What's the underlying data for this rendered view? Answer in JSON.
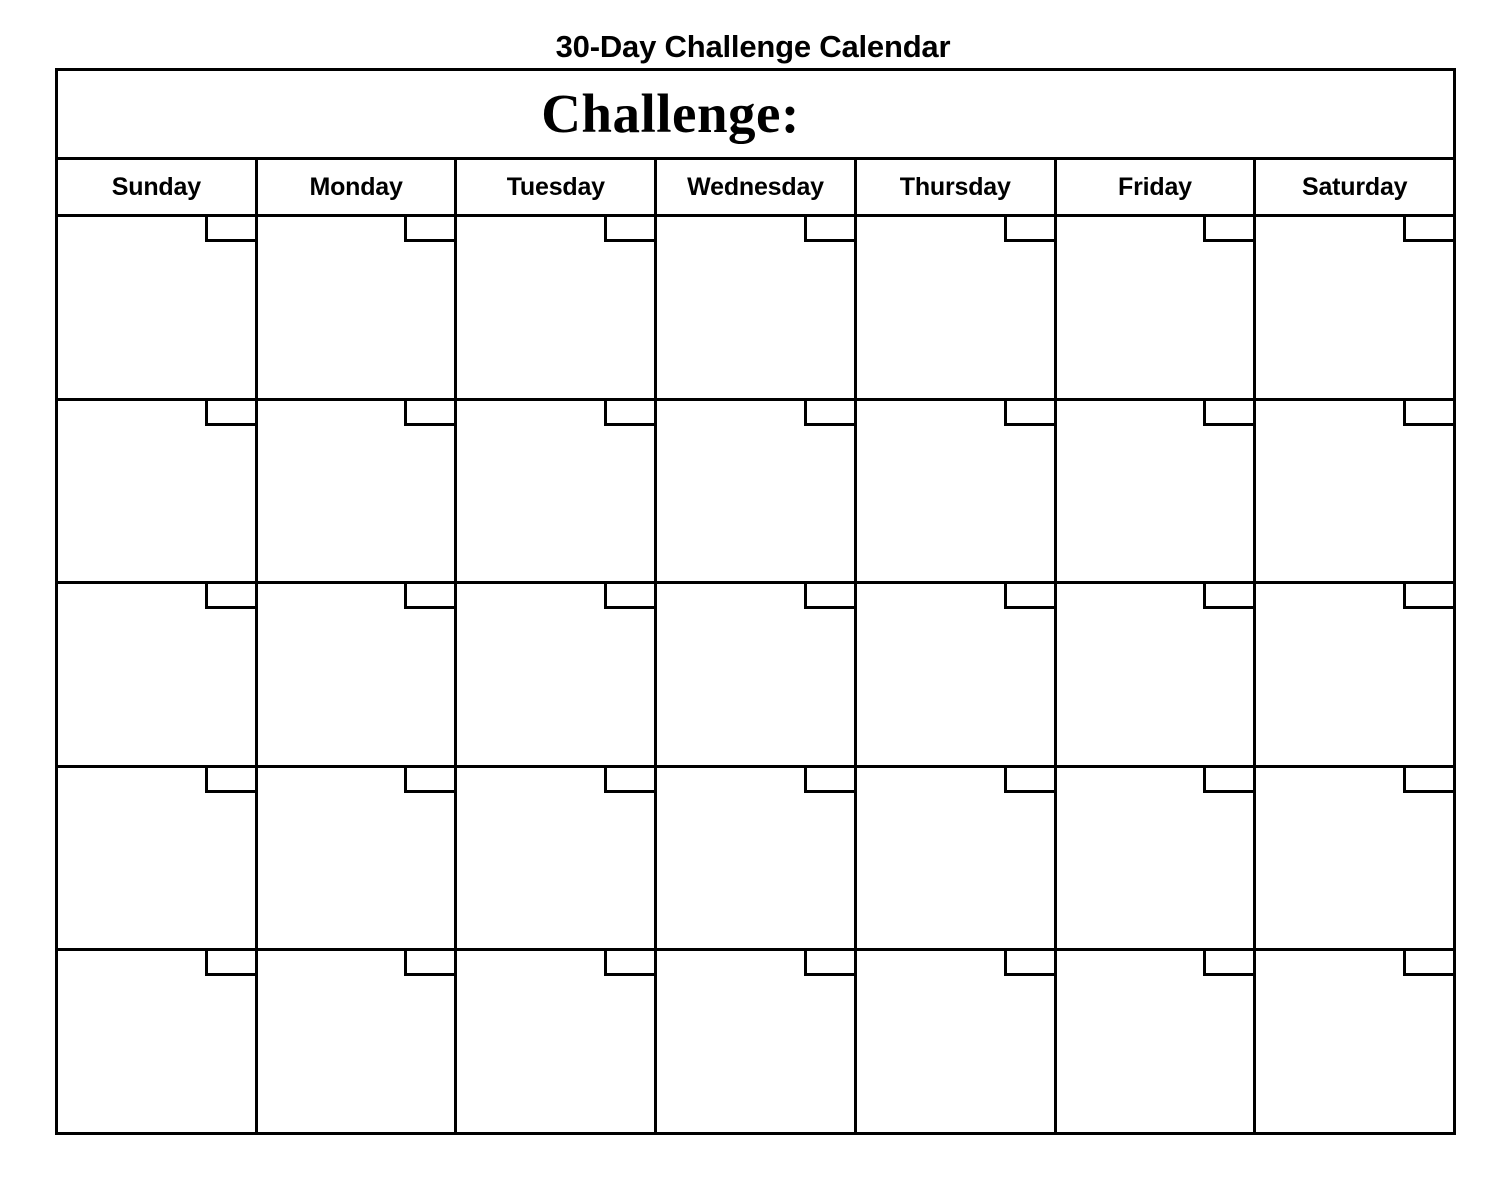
{
  "page": {
    "title": "30-Day Challenge Calendar",
    "background_color": "#ffffff",
    "ink_color": "#000000"
  },
  "calendar": {
    "banner": {
      "label": "Challenge:",
      "value": ""
    },
    "weekdays": [
      "Sunday",
      "Monday",
      "Tuesday",
      "Wednesday",
      "Thursday",
      "Friday",
      "Saturday"
    ],
    "weeks": [
      {
        "days": [
          {
            "date": ""
          },
          {
            "date": ""
          },
          {
            "date": ""
          },
          {
            "date": ""
          },
          {
            "date": ""
          },
          {
            "date": ""
          },
          {
            "date": ""
          }
        ]
      },
      {
        "days": [
          {
            "date": ""
          },
          {
            "date": ""
          },
          {
            "date": ""
          },
          {
            "date": ""
          },
          {
            "date": ""
          },
          {
            "date": ""
          },
          {
            "date": ""
          }
        ]
      },
      {
        "days": [
          {
            "date": ""
          },
          {
            "date": ""
          },
          {
            "date": ""
          },
          {
            "date": ""
          },
          {
            "date": ""
          },
          {
            "date": ""
          },
          {
            "date": ""
          }
        ]
      },
      {
        "days": [
          {
            "date": ""
          },
          {
            "date": ""
          },
          {
            "date": ""
          },
          {
            "date": ""
          },
          {
            "date": ""
          },
          {
            "date": ""
          },
          {
            "date": ""
          }
        ]
      },
      {
        "days": [
          {
            "date": ""
          },
          {
            "date": ""
          },
          {
            "date": ""
          },
          {
            "date": ""
          },
          {
            "date": ""
          },
          {
            "date": ""
          },
          {
            "date": ""
          }
        ]
      }
    ]
  }
}
